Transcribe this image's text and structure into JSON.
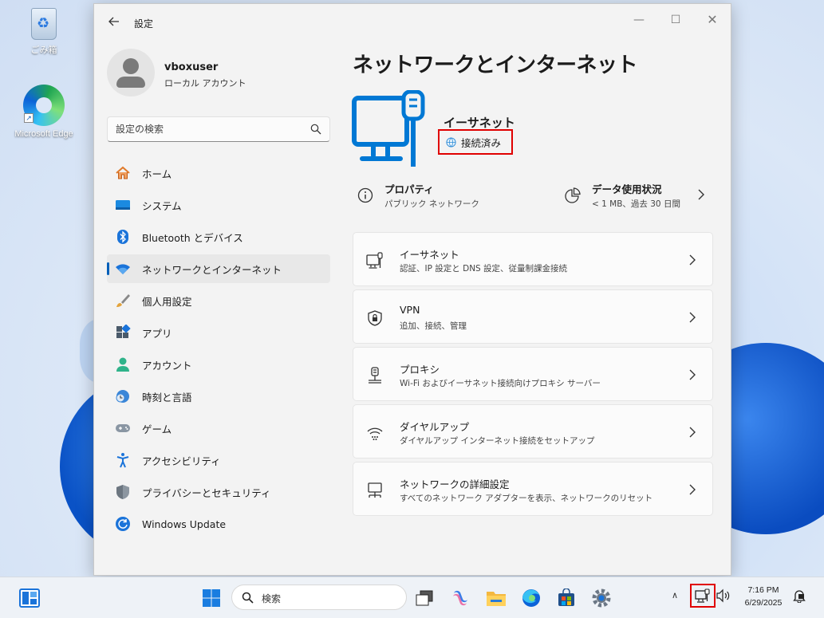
{
  "desktop": {
    "icons": [
      {
        "label": "ごみ箱"
      },
      {
        "label": "Microsoft Edge"
      }
    ]
  },
  "window": {
    "title": "設定",
    "controls": {
      "minimize": "—",
      "maximize": "☐",
      "close": "✕"
    }
  },
  "profile": {
    "name": "vboxuser",
    "account_type": "ローカル アカウント"
  },
  "search": {
    "placeholder": "設定の検索"
  },
  "sidebar": {
    "items": [
      {
        "label": "ホーム",
        "icon": "home-icon"
      },
      {
        "label": "システム",
        "icon": "system-icon"
      },
      {
        "label": "Bluetooth とデバイス",
        "icon": "bluetooth-icon"
      },
      {
        "label": "ネットワークとインターネット",
        "icon": "wifi-icon",
        "active": true
      },
      {
        "label": "個人用設定",
        "icon": "brush-icon"
      },
      {
        "label": "アプリ",
        "icon": "apps-icon"
      },
      {
        "label": "アカウント",
        "icon": "account-icon"
      },
      {
        "label": "時刻と言語",
        "icon": "clock-globe-icon"
      },
      {
        "label": "ゲーム",
        "icon": "gamepad-icon"
      },
      {
        "label": "アクセシビリティ",
        "icon": "accessibility-icon"
      },
      {
        "label": "プライバシーとセキュリティ",
        "icon": "shield-icon"
      },
      {
        "label": "Windows Update",
        "icon": "update-icon"
      }
    ]
  },
  "main": {
    "title": "ネットワークとインターネット",
    "connection": {
      "name": "イーサネット",
      "status": "接続済み"
    },
    "properties": {
      "title": "プロパティ",
      "subtitle": "パブリック ネットワーク"
    },
    "data_usage": {
      "title": "データ使用状況",
      "subtitle": "< 1 MB、過去 30 日間"
    },
    "cards": [
      {
        "title": "イーサネット",
        "subtitle": "認証、IP 設定と DNS 設定、従量制課金接続",
        "icon": "ethernet-monitor-icon"
      },
      {
        "title": "VPN",
        "subtitle": "追加、接続、管理",
        "icon": "vpn-shield-icon"
      },
      {
        "title": "プロキシ",
        "subtitle": "Wi-Fi およびイーサネット接続向けプロキシ サーバー",
        "icon": "proxy-icon"
      },
      {
        "title": "ダイヤルアップ",
        "subtitle": "ダイヤルアップ インターネット接続をセットアップ",
        "icon": "dialup-icon"
      },
      {
        "title": "ネットワークの詳細設定",
        "subtitle": "すべてのネットワーク アダプターを表示、ネットワークのリセット",
        "icon": "network-advanced-icon"
      }
    ]
  },
  "taskbar": {
    "search_placeholder": "検索",
    "clock_time": "7:16 PM",
    "clock_date": "6/29/2025",
    "tray_chevron": "∧"
  },
  "colors": {
    "accent": "#005fb8",
    "highlight_box": "#e00000",
    "icon_blue": "#0078d4"
  }
}
